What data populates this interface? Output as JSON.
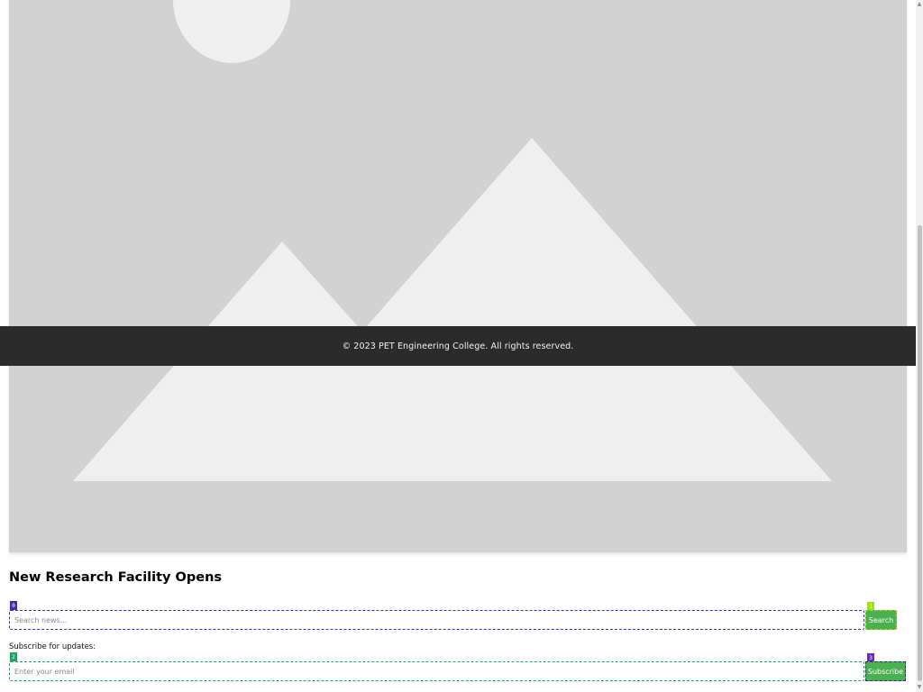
{
  "hero": {
    "icon": "image-placeholder-icon"
  },
  "footer": {
    "copyright": "© 2023 PET Engineering College. All rights reserved."
  },
  "article": {
    "title": "New Research Facility Opens"
  },
  "search": {
    "marker": "0",
    "placeholder": "Search news...",
    "button_marker": "1",
    "button_label": "Search"
  },
  "subscribe": {
    "label": "Subscribe for updates:",
    "marker": "2",
    "placeholder": "Enter your email",
    "button_marker": "3",
    "button_label": "Subscribe"
  },
  "colors": {
    "accent_green": "#4caf50",
    "footer_bg": "#2b2b2b",
    "marker_0": "#3d2db5",
    "marker_1": "#9be21a",
    "marker_2": "#1ea463",
    "marker_3": "#6a2ab5"
  }
}
